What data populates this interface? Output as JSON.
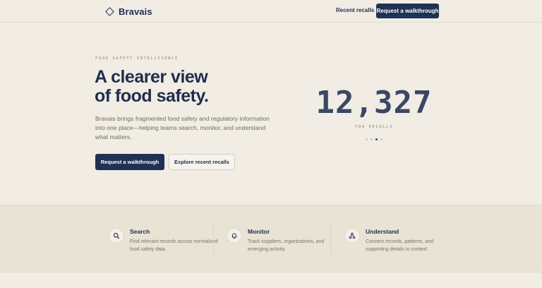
{
  "header": {
    "brand": "Bravais",
    "nav_link": "Recent recalls",
    "cta": "Request a walkthrough"
  },
  "hero": {
    "eyebrow": "FOOD SAFETY INTELLIGENCE",
    "title_line1": "A clearer view",
    "title_line2": "of food safety.",
    "body": "Bravais brings fragmented food safety and regulatory information into one place—helping teams search, monitor, and understand what matters.",
    "primary_cta": "Request a walkthrough",
    "secondary_cta": "Explore recent recalls"
  },
  "stat": {
    "value": "12,327",
    "label": "FDA RECALLS",
    "carousel_dots": 4,
    "active_dot": 2
  },
  "features": [
    {
      "icon": "search-icon",
      "title": "Search",
      "desc": "Find relevant records across normalized food safety data."
    },
    {
      "icon": "bell-icon",
      "title": "Monitor",
      "desc": "Track suppliers, organizations, and emerging activity."
    },
    {
      "icon": "network-icon",
      "title": "Understand",
      "desc": "Connect records, patterns, and supporting details in context."
    }
  ],
  "colors": {
    "background": "#f1ede4",
    "navy": "#1f3154",
    "band": "#e9e3d6"
  }
}
